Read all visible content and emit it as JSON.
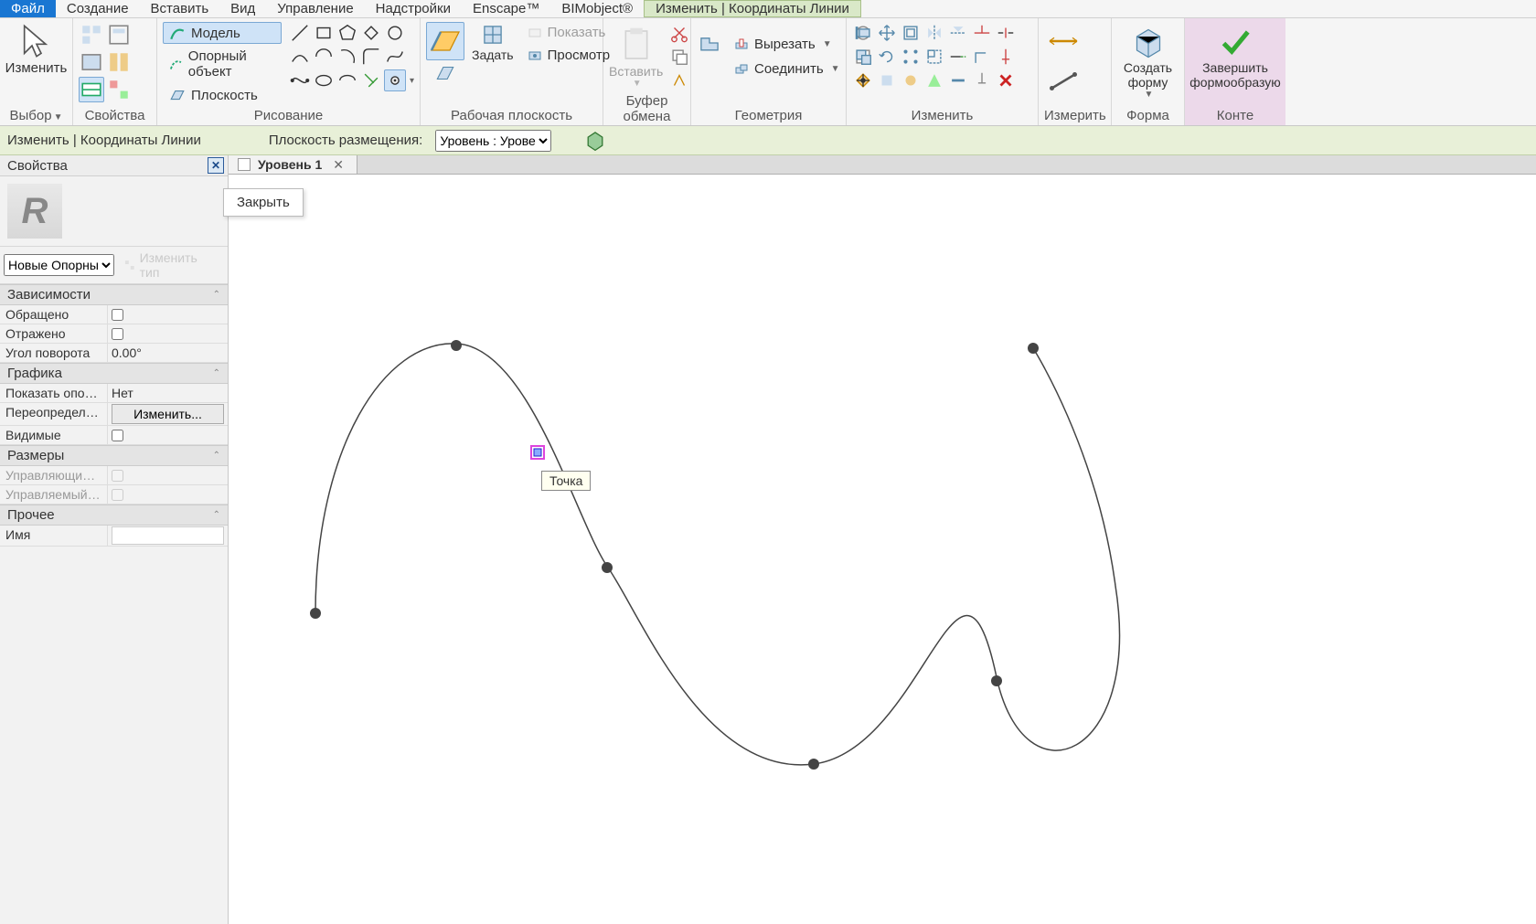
{
  "menu": {
    "file": "Файл",
    "items": [
      "Создание",
      "Вставить",
      "Вид",
      "Управление",
      "Надстройки",
      "Enscape™",
      "BIMobject®"
    ],
    "active_tab": "Изменить | Координаты Линии"
  },
  "ribbon": {
    "selection": {
      "modify": "Изменить",
      "pick": "Выбор",
      "props": "Свойства"
    },
    "draw": {
      "label": "Рисование",
      "model": "Модель",
      "ref": "Опорный объект",
      "plane": "Плоскость"
    },
    "workplane": {
      "label": "Рабочая плоскость",
      "set": "Задать",
      "show": "Показать",
      "view": "Просмотр"
    },
    "clipboard": {
      "label": "Буфер обмена",
      "paste": "Вставить"
    },
    "geometry": {
      "label": "Геометрия",
      "cut": "Вырезать",
      "join": "Соединить"
    },
    "modify": {
      "label": "Изменить"
    },
    "measure": {
      "label": "Измерить"
    },
    "form": {
      "label": "Форма",
      "create": "Создать\nформу"
    },
    "context": {
      "finish": "Завершить\nформообразую",
      "label": "Конте"
    }
  },
  "optbar": {
    "context": "Изменить | Координаты Линии",
    "placement_label": "Плоскость размещения:",
    "placement_value": "Уровень : Урове"
  },
  "props": {
    "title": "Свойства",
    "close_popup": "Закрыть",
    "type_sel": "Новые Опорны",
    "edit_type": "Изменить тип",
    "groups": {
      "deps": {
        "title": "Зависимости",
        "reversed": "Обращено",
        "mirrored": "Отражено",
        "angle": "Угол поворота",
        "angle_val": "0.00°"
      },
      "gfx": {
        "title": "Графика",
        "show_ref": "Показать опор...",
        "show_ref_val": "Нет",
        "override": "Переопределе...",
        "override_btn": "Изменить...",
        "visible": "Видимые"
      },
      "dims": {
        "title": "Размеры",
        "driving": "Управляющие ...",
        "driven": "Управляемый ..."
      },
      "other": {
        "title": "Прочее",
        "name": "Имя"
      }
    }
  },
  "viewtabs": {
    "tab1": "Уровень 1"
  },
  "canvas": {
    "tooltip": "Точка"
  }
}
